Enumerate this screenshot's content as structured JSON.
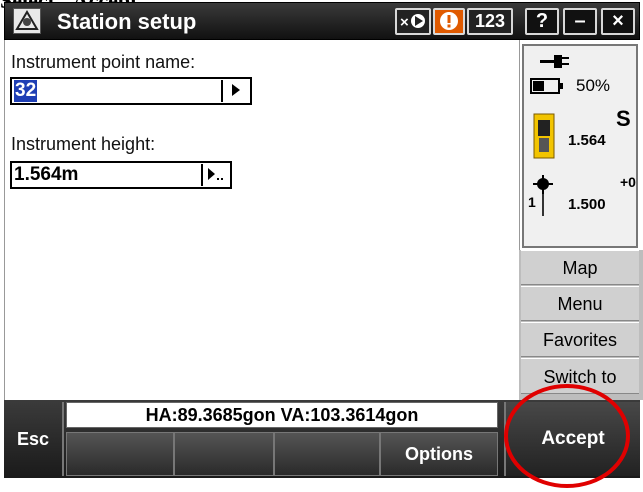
{
  "caption": "Select \"Accept\"",
  "window": {
    "title": "Station setup",
    "status_badge": "123",
    "help_label": "?",
    "minimize_label": "–",
    "close_label": "×"
  },
  "form": {
    "point_name_label": "Instrument point name:",
    "point_name_value": "32",
    "height_label": "Instrument height:",
    "height_value": "1.564m"
  },
  "status": {
    "battery_percent": "50%",
    "face_letter": "S",
    "instrument_height": "1.564",
    "prism_offset": "+0",
    "target_number": "1",
    "target_height": "1.500"
  },
  "sidebar": {
    "map": "Map",
    "menu": "Menu",
    "favorites": "Favorites",
    "switch_to": "Switch to"
  },
  "readout": "HA:89.3685gon  VA:103.3614gon",
  "softkeys": {
    "esc": "Esc",
    "options": "Options",
    "accept": "Accept"
  }
}
